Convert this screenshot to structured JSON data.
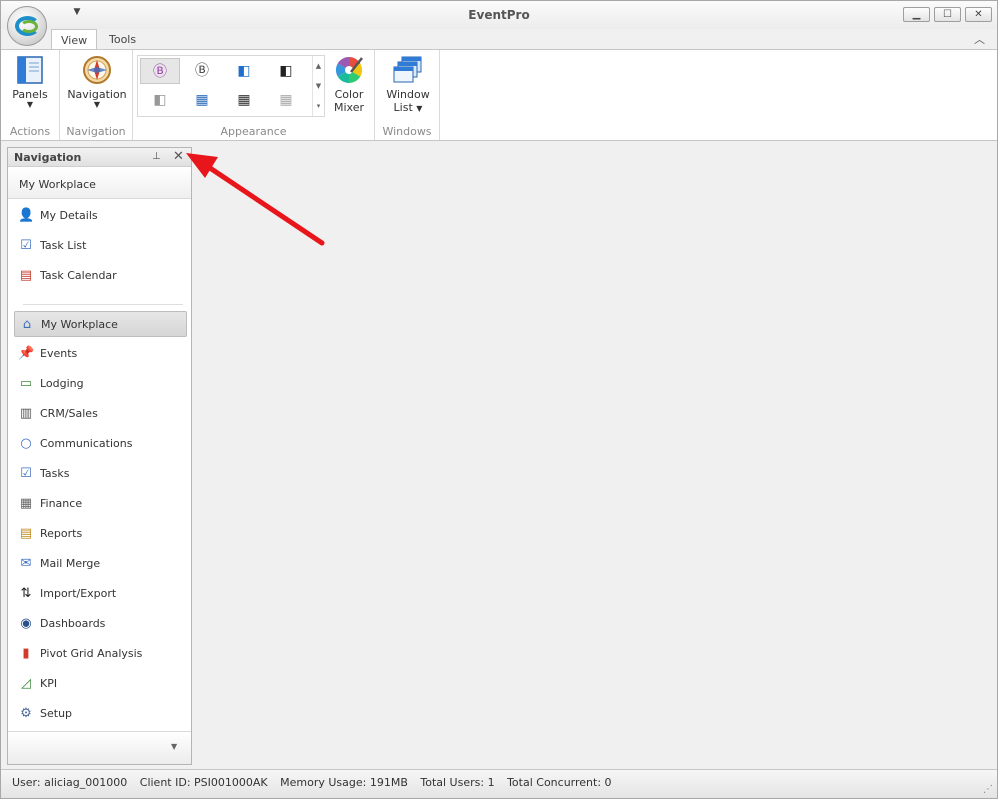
{
  "window": {
    "title": "EventPro"
  },
  "ribbon": {
    "tabs": [
      {
        "label": "View"
      },
      {
        "label": "Tools"
      }
    ],
    "groups": {
      "actions": {
        "caption": "Actions",
        "panels_label": "Panels"
      },
      "navigation": {
        "caption": "Navigation",
        "navigation_label": "Navigation"
      },
      "appearance": {
        "caption": "Appearance",
        "color_mixer_line1": "Color",
        "color_mixer_line2": "Mixer"
      },
      "windows": {
        "caption": "Windows",
        "window_list_line1": "Window",
        "window_list_line2": "List"
      }
    }
  },
  "nav_panel": {
    "title": "Navigation",
    "section_title": "My Workplace",
    "top_items": [
      {
        "label": "My Details",
        "icon": "user-info-icon"
      },
      {
        "label": "Task List",
        "icon": "task-list-icon"
      },
      {
        "label": "Task Calendar",
        "icon": "calendar-icon"
      }
    ],
    "modules": [
      {
        "label": "My Workplace",
        "icon": "home-icon",
        "active": true
      },
      {
        "label": "Events",
        "icon": "pushpin-icon"
      },
      {
        "label": "Lodging",
        "icon": "lodging-icon"
      },
      {
        "label": "CRM/Sales",
        "icon": "crm-icon"
      },
      {
        "label": "Communications",
        "icon": "speech-bubble-icon"
      },
      {
        "label": "Tasks",
        "icon": "clipboard-icon"
      },
      {
        "label": "Finance",
        "icon": "calculator-icon"
      },
      {
        "label": "Reports",
        "icon": "report-icon"
      },
      {
        "label": "Mail Merge",
        "icon": "mail-merge-icon"
      },
      {
        "label": "Import/Export",
        "icon": "import-export-icon"
      },
      {
        "label": "Dashboards",
        "icon": "dashboard-icon"
      },
      {
        "label": "Pivot Grid Analysis",
        "icon": "pivot-grid-icon"
      },
      {
        "label": "KPI",
        "icon": "kpi-chart-icon"
      },
      {
        "label": "Setup",
        "icon": "gear-icon"
      }
    ]
  },
  "status_bar": {
    "user": "User: aliciag_001000",
    "client_id": "Client ID: PSI001000AK",
    "memory": "Memory Usage: 191MB",
    "total_users": "Total Users: 1",
    "total_concurrent": "Total Concurrent: 0"
  },
  "colors": {
    "accent_blue": "#1e8fc8",
    "accent_green": "#6ab43e",
    "annotation_arrow": "#e8151b"
  }
}
